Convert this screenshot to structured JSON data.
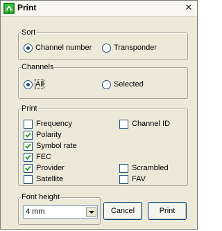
{
  "window": {
    "title": "Print",
    "close_glyph": "✕"
  },
  "sort": {
    "label": "Sort",
    "options": [
      {
        "label": "Channel number",
        "selected": true
      },
      {
        "label": "Transponder",
        "selected": false
      }
    ]
  },
  "channels": {
    "label": "Channels",
    "options": [
      {
        "label": "All",
        "selected": true
      },
      {
        "label": "Selected",
        "selected": false
      }
    ]
  },
  "print": {
    "label": "Print",
    "items": [
      {
        "label": "Frequency",
        "checked": false
      },
      {
        "label": "Polarity",
        "checked": true
      },
      {
        "label": "Symbol rate",
        "checked": true
      },
      {
        "label": "FEC",
        "checked": true
      },
      {
        "label": "Provider",
        "checked": true
      },
      {
        "label": "Satellite",
        "checked": false
      },
      {
        "label": "Channel ID",
        "checked": false
      },
      {
        "label": "Scrambled",
        "checked": false
      },
      {
        "label": "FAV",
        "checked": false
      }
    ]
  },
  "font_height": {
    "label": "Font height",
    "value": "4 mm"
  },
  "buttons": {
    "cancel": "Cancel",
    "print": "Print"
  },
  "icons": {
    "app": "print-app-icon",
    "close": "close-icon",
    "dropdown": "chevron-down-icon",
    "check": "checkmark-icon"
  },
  "colors": {
    "dialog_bg": "#ece9d8",
    "control_border": "#1c5180"
  }
}
